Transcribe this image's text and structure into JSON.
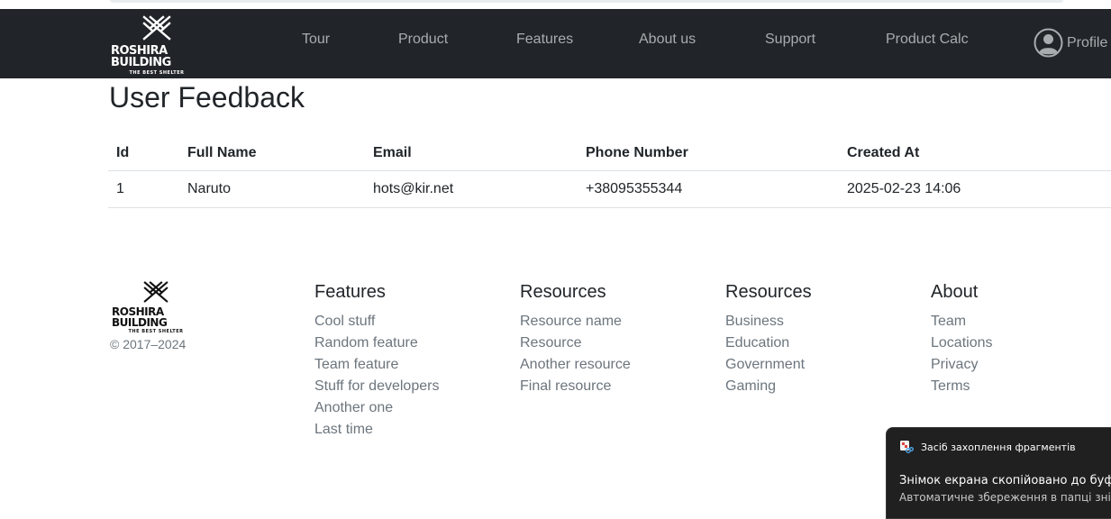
{
  "navbar": {
    "brand": "ROSHIRA BUILDING",
    "tagline": "THE BEST SHELTER",
    "links": [
      "Tour",
      "Product",
      "Features",
      "About us",
      "Support",
      "Product Calc"
    ],
    "profile_label": "Profile"
  },
  "page": {
    "title": "User Feedback"
  },
  "table": {
    "headers": [
      "Id",
      "Full Name",
      "Email",
      "Phone Number",
      "Created At"
    ],
    "rows": [
      [
        "1",
        "Naruto",
        "hots@kir.net",
        "+38095355344",
        "2025-02-23 14:06"
      ]
    ]
  },
  "footer": {
    "brand": "ROSHIRA BUILDING",
    "tagline": "THE BEST SHELTER",
    "copyright": "© 2017–2024",
    "columns": [
      {
        "title": "Features",
        "items": [
          "Cool stuff",
          "Random feature",
          "Team feature",
          "Stuff for developers",
          "Another one",
          "Last time"
        ]
      },
      {
        "title": "Resources",
        "items": [
          "Resource name",
          "Resource",
          "Another resource",
          "Final resource"
        ]
      },
      {
        "title": "Resources",
        "items": [
          "Business",
          "Education",
          "Government",
          "Gaming"
        ]
      },
      {
        "title": "About",
        "items": [
          "Team",
          "Locations",
          "Privacy",
          "Terms"
        ]
      }
    ]
  },
  "toast": {
    "app_name": "Засіб захоплення фрагментів",
    "message": "Знімок екрана скопійовано до буфера обміну",
    "detail": "Автоматичне збереження в папці знімків екрана"
  },
  "colors": {
    "navbar_bg": "#212529",
    "nav_link": "#a9acaf",
    "muted_text": "#6c757d",
    "toast_bg": "#202020"
  },
  "icons": [
    "roshira-logo-icon",
    "profile-icon",
    "snipping-tool-icon"
  ]
}
